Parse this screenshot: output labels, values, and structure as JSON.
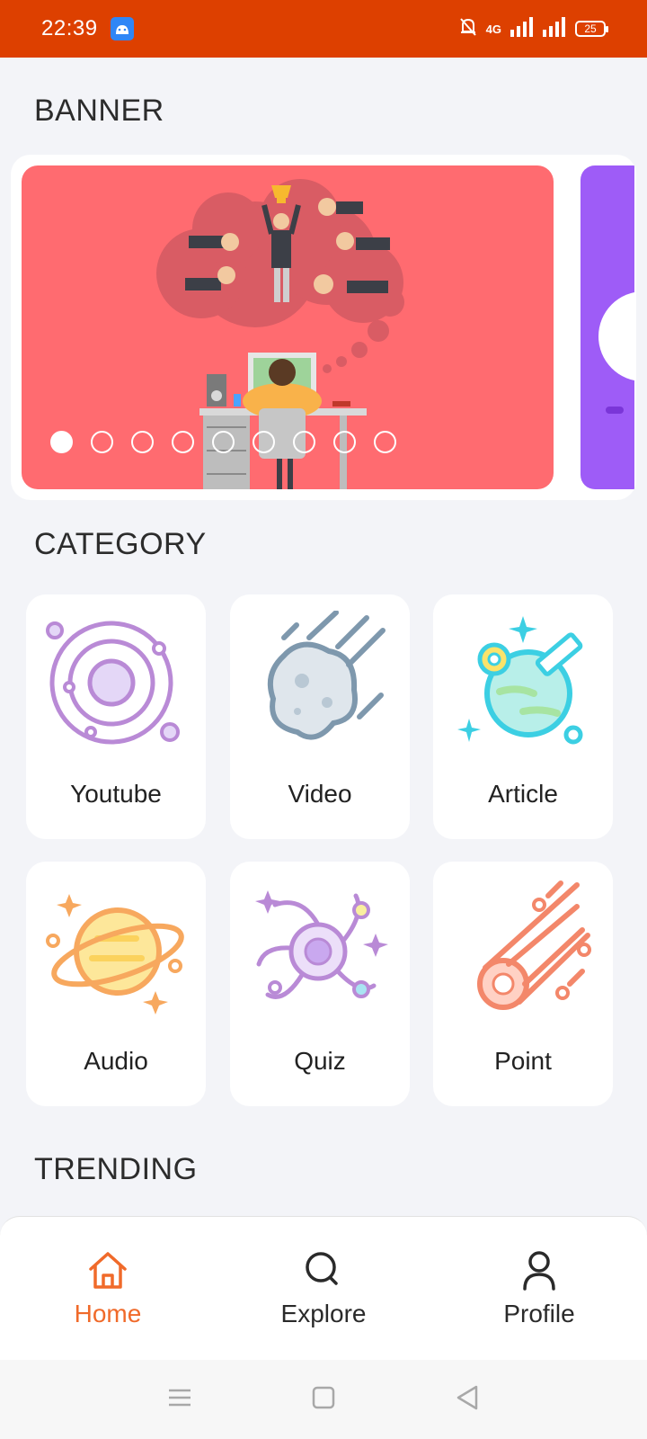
{
  "status_bar": {
    "time": "22:39",
    "network": "4G",
    "battery": "25",
    "icons": [
      "android-app-icon",
      "mute-bell-icon",
      "signal-icon",
      "signal-icon",
      "battery-icon"
    ]
  },
  "sections": {
    "banner_title": "BANNER",
    "category_title": "CATEGORY",
    "trending_title": "TRENDING"
  },
  "banner": {
    "slide_count": 9,
    "active_index": 0
  },
  "categories": [
    {
      "label": "Youtube",
      "icon": "planet-orbit-icon"
    },
    {
      "label": "Video",
      "icon": "asteroid-icon"
    },
    {
      "label": "Article",
      "icon": "earth-satellite-icon"
    },
    {
      "label": "Audio",
      "icon": "ringed-planet-icon"
    },
    {
      "label": "Quiz",
      "icon": "galaxy-icon"
    },
    {
      "label": "Point",
      "icon": "comet-icon"
    }
  ],
  "bottom_nav": {
    "home": "Home",
    "explore": "Explore",
    "profile": "Profile",
    "active": "home"
  },
  "colors": {
    "status_bar": "#dd4000",
    "accent": "#f06a2a",
    "banner_bg": "#ff6b70",
    "banner_next_bg": "#9e5cf7",
    "page_bg": "#f3f4f8"
  }
}
